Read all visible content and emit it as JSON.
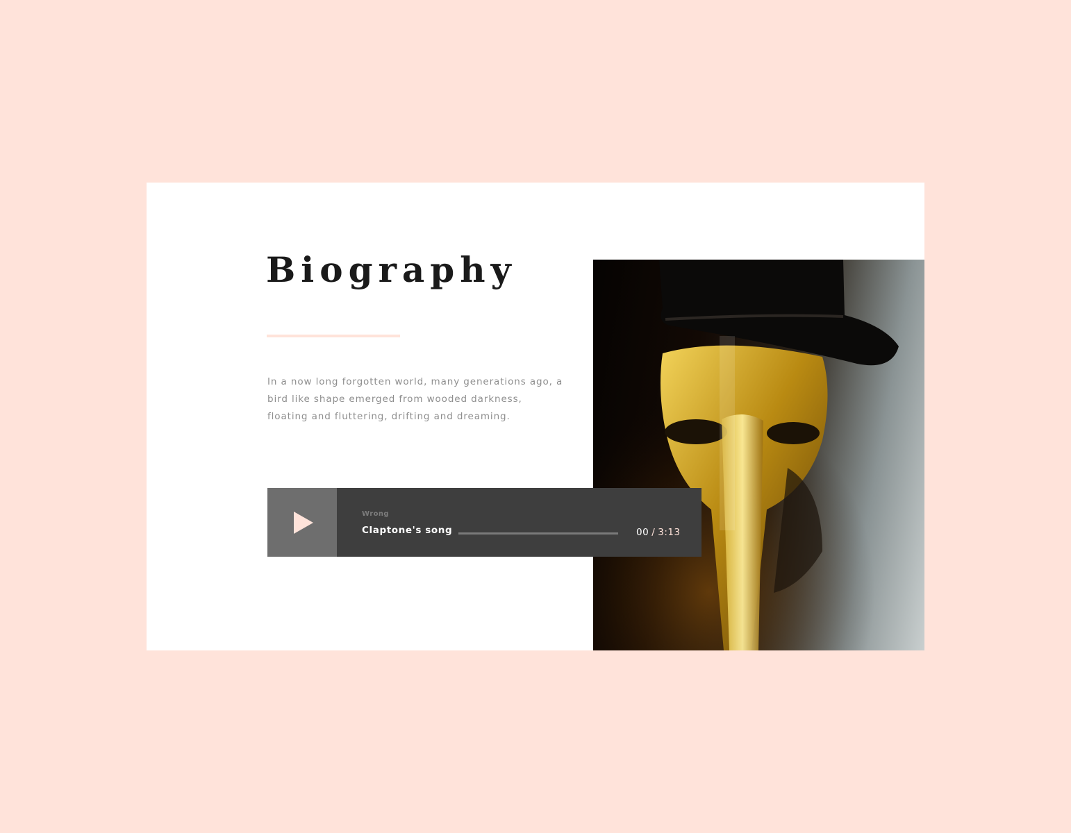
{
  "biography": {
    "title": "Biography",
    "text": "In a now long forgotten world, many generations ago, a bird like shape emerged from wooded darkness, floating and fluttering, drifting and dreaming."
  },
  "player": {
    "artist": "Wrong",
    "track_title": "Claptone's song",
    "current_time": "00",
    "separator": "/",
    "total_time": "3:13",
    "progress": 0,
    "play_icon": "play-icon"
  },
  "colors": {
    "background": "#ffe3da",
    "card": "#ffffff",
    "title": "#1a1a1a",
    "body_text": "#8e8e8e",
    "player_bg": "#3e3e3e",
    "play_button_bg": "#6e6e6e",
    "accent": "#ffe3da"
  }
}
